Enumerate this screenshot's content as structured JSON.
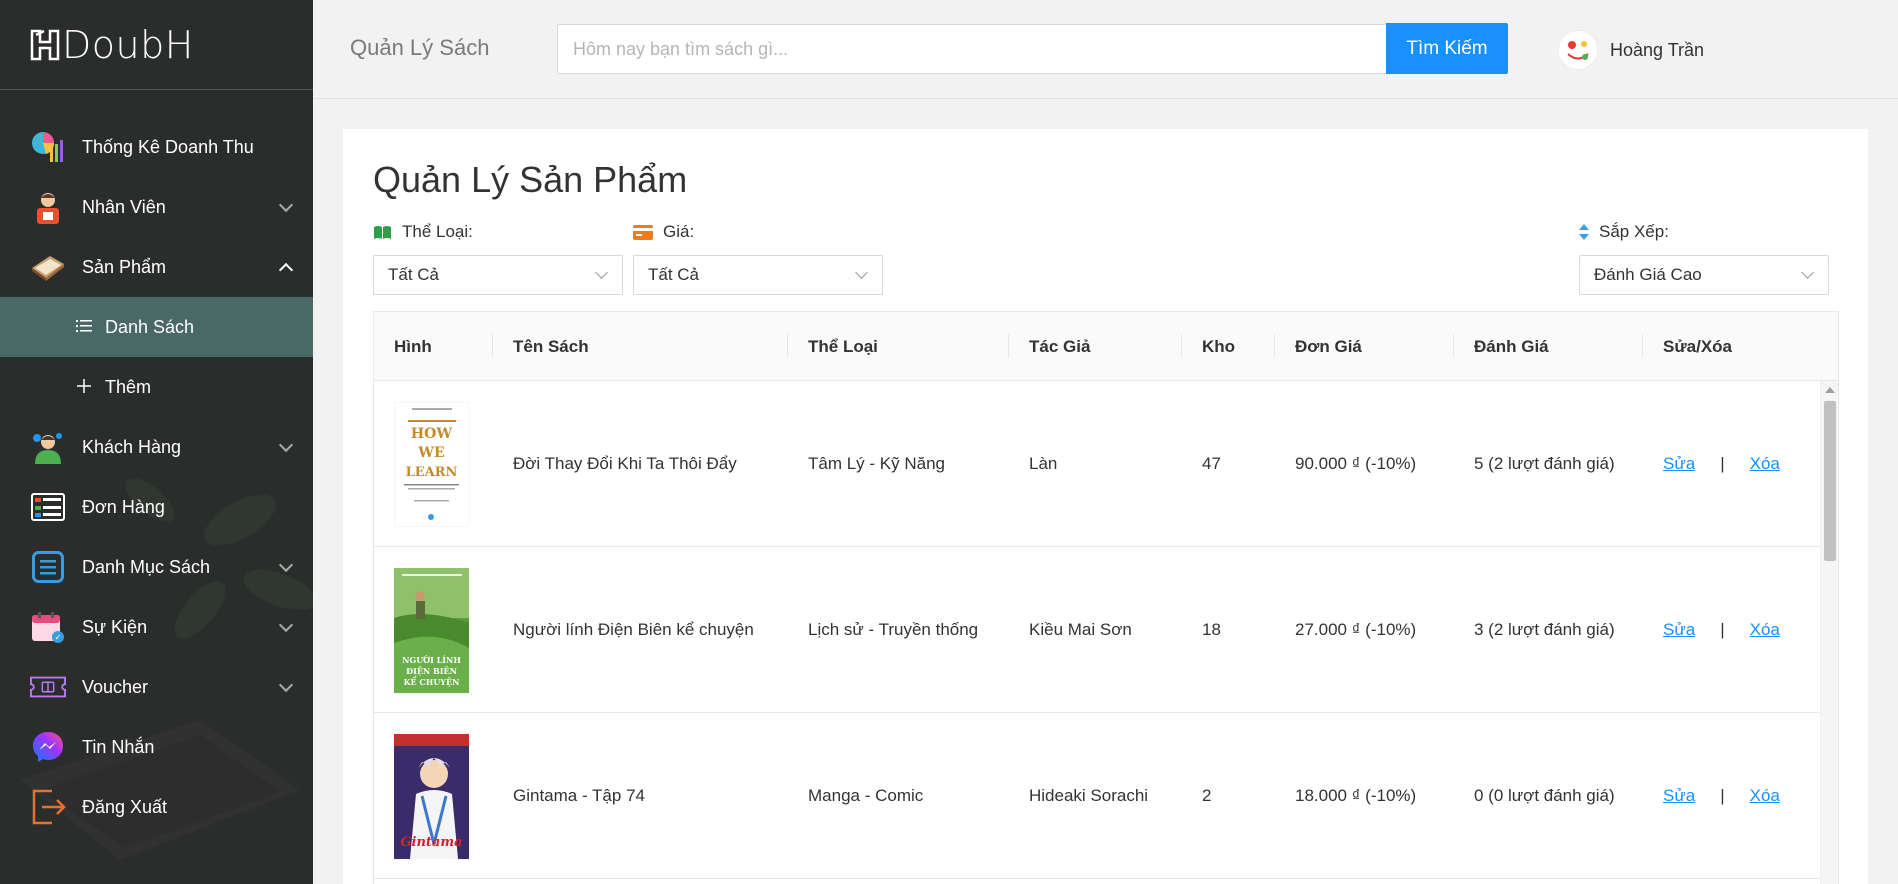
{
  "logo": {
    "text": "DoubH"
  },
  "sidebar": {
    "items": [
      {
        "label": "Thống Kê Doanh Thu",
        "icon": "chart-pie-icon",
        "has_chevron": false
      },
      {
        "label": "Nhân Viên",
        "icon": "employee-icon",
        "has_chevron": true
      },
      {
        "label": "Sản Phẩm",
        "icon": "book-icon",
        "has_chevron": true,
        "expanded": true
      },
      {
        "label": "Khách Hàng",
        "icon": "customer-icon",
        "has_chevron": true
      },
      {
        "label": "Đơn Hàng",
        "icon": "order-icon",
        "has_chevron": false
      },
      {
        "label": "Danh Mục Sách",
        "icon": "list-icon",
        "has_chevron": true
      },
      {
        "label": "Sự Kiện",
        "icon": "calendar-icon",
        "has_chevron": true
      },
      {
        "label": "Voucher",
        "icon": "ticket-icon",
        "has_chevron": true
      },
      {
        "label": "Tin Nhắn",
        "icon": "messenger-icon",
        "has_chevron": false
      },
      {
        "label": "Đăng Xuất",
        "icon": "logout-icon",
        "has_chevron": false
      }
    ],
    "subitems": [
      {
        "label": "Danh Sách",
        "icon": "list-bullets-icon",
        "active": true
      },
      {
        "label": "Thêm",
        "icon": "plus-icon",
        "active": false
      }
    ]
  },
  "topbar": {
    "title": "Quản Lý Sách",
    "search_placeholder": "Hôm nay bạn tìm sách gì...",
    "search_button": "Tìm Kiếm",
    "user_name": "Hoàng Trần"
  },
  "page": {
    "title": "Quản Lý Sản Phẩm",
    "filters": {
      "category": {
        "label": "Thể Loại:",
        "value": "Tất Cả"
      },
      "price": {
        "label": "Giá:",
        "value": "Tất Cả"
      },
      "sort": {
        "label": "Sắp Xếp:",
        "value": "Đánh Giá Cao"
      }
    }
  },
  "table": {
    "headers": [
      "Hình",
      "Tên Sách",
      "Thể Loại",
      "Tác Giả",
      "Kho",
      "Đơn Giá",
      "Đánh Giá",
      "Sửa/Xóa"
    ],
    "edit_label": "Sửa",
    "delete_label": "Xóa",
    "separator": "|",
    "rows": [
      {
        "name": "Đời Thay Đổi Khi Ta Thôi Đẩy",
        "category": "Tâm Lý - Kỹ Năng",
        "author": "Làn",
        "stock": "47",
        "price": "90.000 ₫ (-10%)",
        "rating": "5 (2 lượt đánh giá)",
        "cover": "how-we-learn",
        "cover_title": "HOW WE LEARN"
      },
      {
        "name": "Người lính Điện Biên kể chuyện",
        "category": "Lịch sử - Truyền thống",
        "author": "Kiều Mai Sơn",
        "stock": "18",
        "price": "27.000 ₫ (-10%)",
        "rating": "3 (2 lượt đánh giá)",
        "cover": "dien-bien",
        "cover_title": "NGƯỜI LÍNH ĐIỆN BIÊN KỂ CHUYỆN"
      },
      {
        "name": "Gintama - Tập 74",
        "category": "Manga - Comic",
        "author": "Hideaki Sorachi",
        "stock": "2",
        "price": "18.000 ₫ (-10%)",
        "rating": "0 (0 lượt đánh giá)",
        "cover": "gintama",
        "cover_title": "Gintama"
      }
    ]
  },
  "colors": {
    "sidebar_bg": "#2b2d2d",
    "active_sub_bg": "#4a6866",
    "accent": "#1890ff"
  }
}
